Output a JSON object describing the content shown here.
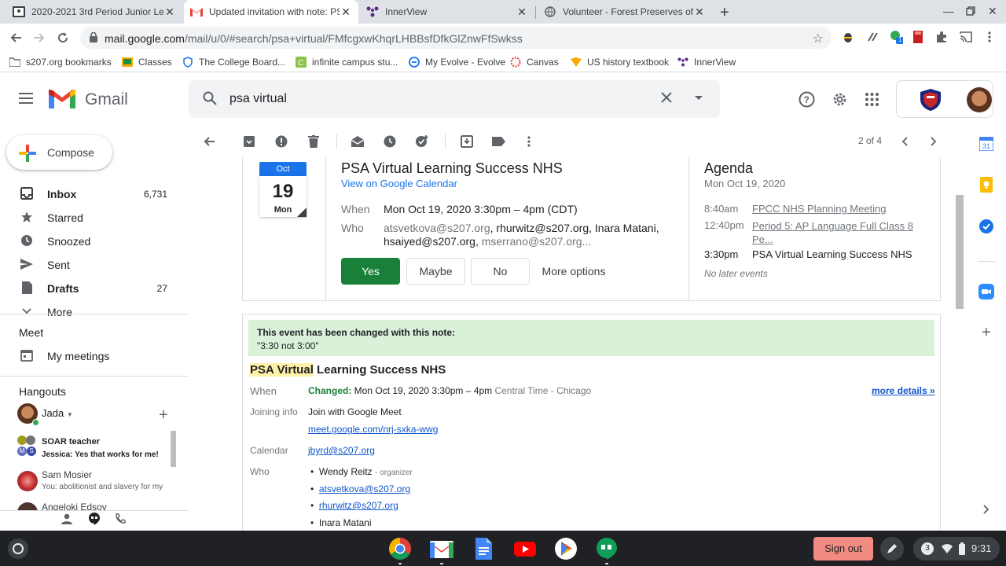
{
  "browser": {
    "tabs": [
      {
        "title": "2020-2021 3rd Period Junior Le",
        "icon": "classroom-icon"
      },
      {
        "title": "Updated invitation with note: PS",
        "icon": "gmail-icon",
        "active": true
      },
      {
        "title": "InnerView",
        "icon": "innerview-icon"
      },
      {
        "title": "Volunteer - Forest Preserves of C",
        "icon": "globe-icon"
      }
    ],
    "url_host": "mail.google.com",
    "url_path": "/mail/u/0/#search/psa+virtual/FMfcgxwKhqrLHBBsfDfkGlZnwFfSwkss",
    "bookmarks": [
      {
        "label": "s207.org bookmarks",
        "icon": "folder-icon"
      },
      {
        "label": "Classes",
        "icon": "classes-icon"
      },
      {
        "label": "The College Board...",
        "icon": "shield-icon"
      },
      {
        "label": "infinite campus stu...",
        "icon": "campus-icon"
      },
      {
        "label": "My Evolve - Evolve",
        "icon": "evolve-icon"
      },
      {
        "label": "Canvas",
        "icon": "canvas-icon"
      },
      {
        "label": "US history textbook",
        "icon": "textbook-icon"
      },
      {
        "label": "InnerView",
        "icon": "innerview-icon"
      }
    ],
    "ext_badge": "1"
  },
  "gmail": {
    "logo_text": "Gmail",
    "search_value": "psa virtual",
    "compose_label": "Compose",
    "nav": [
      {
        "label": "Inbox",
        "count": "6,731",
        "icon": "inbox-icon",
        "bold": true
      },
      {
        "label": "Starred",
        "count": "",
        "icon": "star-icon"
      },
      {
        "label": "Snoozed",
        "count": "",
        "icon": "clock-icon"
      },
      {
        "label": "Sent",
        "count": "",
        "icon": "send-icon"
      },
      {
        "label": "Drafts",
        "count": "27",
        "icon": "draft-icon",
        "bold": true
      },
      {
        "label": "More",
        "count": "",
        "icon": "chevron-down-icon"
      }
    ],
    "meet_title": "Meet",
    "meet_item": "My meetings",
    "hangouts_title": "Hangouts",
    "hangouts_user": "Jada",
    "chats": [
      {
        "name": "SOAR teacher",
        "preview": "Jessica: Yes that works for me!",
        "bold": true
      },
      {
        "name": "Sam Mosier",
        "preview": "You: abolitionist and slavery for my"
      },
      {
        "name": "Angeloki Edsov",
        "preview": ""
      }
    ],
    "pager": "2 of 4"
  },
  "invite": {
    "month": "Oct",
    "day": "19",
    "weekday": "Mon",
    "title": "PSA Virtual Learning Success NHS",
    "view_link": "View on Google Calendar",
    "when_label": "When",
    "when_value": "Mon Oct 19, 2020 3:30pm – 4pm (CDT)",
    "who_label": "Who",
    "who_1": "atsvetkova@s207.org",
    "who_2": ", rhurwitz@s207.org, Inara Matani,",
    "who_3": "hsaiyed@s207.org",
    "who_4": ", ",
    "who_5": "mserrano@s207.org...",
    "btn_yes": "Yes",
    "btn_maybe": "Maybe",
    "btn_no": "No",
    "btn_more": "More options",
    "agenda_title": "Agenda",
    "agenda_date": "Mon Oct 19, 2020",
    "agenda": [
      {
        "time": "8:40am",
        "title": "FPCC NHS Planning Meeting",
        "past": true
      },
      {
        "time": "12:40pm",
        "title": "Period 5: AP Language Full Class 8 Pe...",
        "past": true
      },
      {
        "time": "3:30pm",
        "title": "PSA Virtual Learning Success NHS",
        "past": false
      }
    ],
    "no_later": "No later events"
  },
  "event": {
    "note_heading": "This event has been changed with this note:",
    "note_text": "\"3:30 not 3:00\"",
    "title_hl": "PSA Virtual",
    "title_rest": " Learning Success NHS",
    "when_label": "When",
    "changed": "Changed:",
    "when_value": " Mon Oct 19, 2020 3:30pm – 4pm ",
    "tz": "Central Time - Chicago",
    "more_details": "more details »",
    "joining_label": "Joining info",
    "joining_text": "Join with Google Meet",
    "meet_link": "meet.google.com/nrj-sxka-wwg",
    "calendar_label": "Calendar",
    "calendar_value": "jbyrd@s207.org",
    "who_label": "Who",
    "guests": [
      {
        "name": "Wendy Reitz",
        "role": "- organizer",
        "link": false
      },
      {
        "name": "atsvetkova@s207.org",
        "role": "",
        "link": true
      },
      {
        "name": "rhurwitz@s207.org",
        "role": "",
        "link": true
      },
      {
        "name": "Inara Matani",
        "role": "",
        "link": false
      }
    ]
  },
  "shelf": {
    "sign_out": "Sign out",
    "notif_count": "3",
    "time": "9:31"
  },
  "colors": {
    "accent_green": "#188038",
    "link_blue": "#1155cc",
    "note_bg": "#d9f1d9",
    "signout_bg": "#f28b82"
  }
}
